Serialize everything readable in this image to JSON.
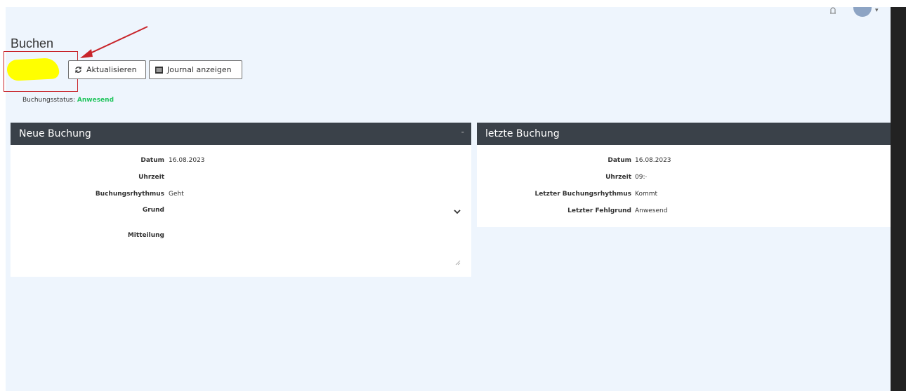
{
  "page": {
    "title": "Buchen"
  },
  "toolbar": {
    "refresh_label": "Aktualisieren",
    "journal_label": "Journal anzeigen"
  },
  "status": {
    "label": "Buchungsstatus:",
    "value": "Anwesend",
    "value_color": "#22c55e"
  },
  "new_booking": {
    "title": "Neue Buchung",
    "collapse_symbol": "-",
    "rows": {
      "datum_label": "Datum",
      "datum_value": "16.08.2023",
      "uhrzeit_label": "Uhrzeit",
      "rhythmus_label": "Buchungsrhythmus",
      "rhythmus_value": "Geht",
      "grund_label": "Grund",
      "mitteilung_label": "Mitteilung"
    }
  },
  "last_booking": {
    "title": "letzte Buchung",
    "rows": {
      "datum_label": "Datum",
      "datum_value": "16.08.2023",
      "uhrzeit_label": "Uhrzeit",
      "uhrzeit_value": "09:·",
      "rhythmus_label": "Letzter Buchungsrhythmus",
      "rhythmus_value": "Kommt",
      "fehlgrund_label": "Letzter Fehlgrund",
      "fehlgrund_value": "Anwesend"
    }
  },
  "colors": {
    "header_bg": "#3a4149",
    "page_bg": "#eef5fd",
    "annotation": "#c8242a",
    "highlight": "#ffff00"
  },
  "icons": [
    "bell-icon",
    "avatar",
    "refresh-icon",
    "list-icon",
    "chevron-down-icon",
    "resize-handle-icon"
  ]
}
